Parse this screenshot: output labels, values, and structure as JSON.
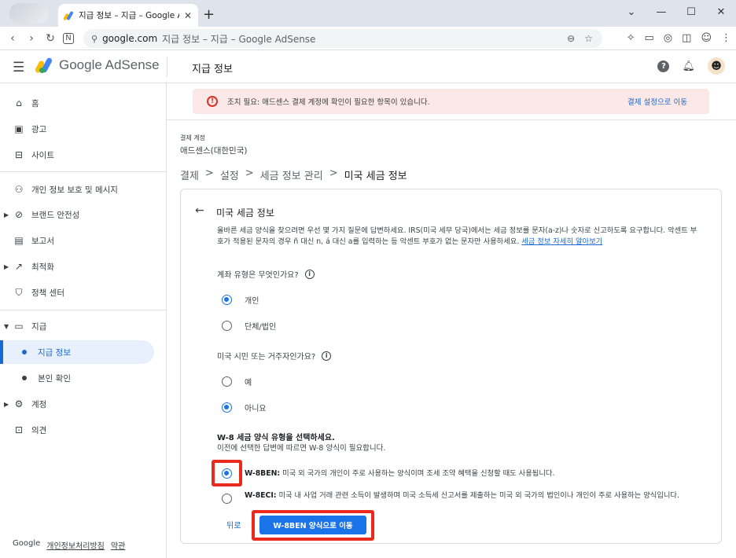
{
  "browser": {
    "tab_title": "지급 정보 – 지급 – Google AdSe",
    "tab_close": "✕",
    "new_tab": "+",
    "url_host": "google.com",
    "url_rest": "지급 정보 – 지급 – Google AdSense"
  },
  "header": {
    "brand": "Google AdSense",
    "page_title": "지급 정보"
  },
  "sidebar": {
    "items": [
      {
        "label": "홈",
        "icon": "home-icon"
      },
      {
        "label": "광고",
        "icon": "ads-icon"
      },
      {
        "label": "사이트",
        "icon": "sites-icon"
      },
      {
        "label": "개인 정보 보호 및 메시지",
        "icon": "privacy-icon"
      },
      {
        "label": "브랜드 안전성",
        "icon": "block-icon"
      },
      {
        "label": "보고서",
        "icon": "reports-icon"
      },
      {
        "label": "최적화",
        "icon": "trend-icon"
      },
      {
        "label": "정책 센터",
        "icon": "shield-icon"
      },
      {
        "label": "지급",
        "icon": "payments-icon"
      },
      {
        "label": "지급 정보",
        "icon": ""
      },
      {
        "label": "본인 확인",
        "icon": ""
      },
      {
        "label": "계정",
        "icon": "gear-icon"
      },
      {
        "label": "의견",
        "icon": "feedback-icon"
      }
    ],
    "footer_google": "Google",
    "footer_privacy": "개인정보처리방침",
    "footer_terms": "약관"
  },
  "alert": {
    "text": "조치 필요: 애드센스 결제 계정에 확인이 필요한 항목이 있습니다.",
    "link": "결제 설정으로 이동"
  },
  "account": {
    "label": "결제 계정",
    "value": "애드센스(대한민국)"
  },
  "breadcrumb": [
    "결제",
    "설정",
    "세금 정보 관리",
    "미국 세금 정보"
  ],
  "breadcrumb_sep": ">",
  "card": {
    "title": "미국 세금 정보",
    "desc": "올바른 세금 양식을 찾으려면 우선 몇 가지 질문에 답변하세요. IRS(미국 세무 당국)에서는 세금 정보를 문자(a-z)나 숫자로 신고하도록 요구합니다. 악센트 부호가 적용된 문자의 경우 ñ 대신 n, á 대신 a를 입력하는 등 악센트 부호가 없는 문자만 사용하세요. ",
    "desc_link": "세금 정보 자세히 알아보기",
    "q1": "계좌 유형은 무엇인가요?",
    "q1_options": [
      "개인",
      "단체/법인"
    ],
    "q2": "미국 시민 또는 거주자인가요?",
    "q2_options": [
      "예",
      "아니요"
    ],
    "w8_heading": "W-8 세금 양식 유형을 선택하세요.",
    "w8_sub": "이전에 선택한 답변에 따르면 W-8 양식이 필요합니다.",
    "w8ben_label": "W-8BEN:",
    "w8ben_text": " 미국 외 국가의 개인이 주로 사용하는 양식이며 조세 조약 혜택을 신청할 때도 사용됩니다.",
    "w8eci_label": "W-8ECI:",
    "w8eci_text": " 미국 내 사업 거래 관련 소득이 발생하며 미국 소득세 신고서를 제출하는 미국 외 국가의 법인이나 개인이 주로 사용하는 양식입니다.",
    "back_label": "뒤로",
    "continue_label": "W-8BEN 양식으로 이동"
  },
  "colors": {
    "accent": "#1a73e8",
    "highlight": "#ea2a1c",
    "alert_bg": "#fce8e6"
  }
}
